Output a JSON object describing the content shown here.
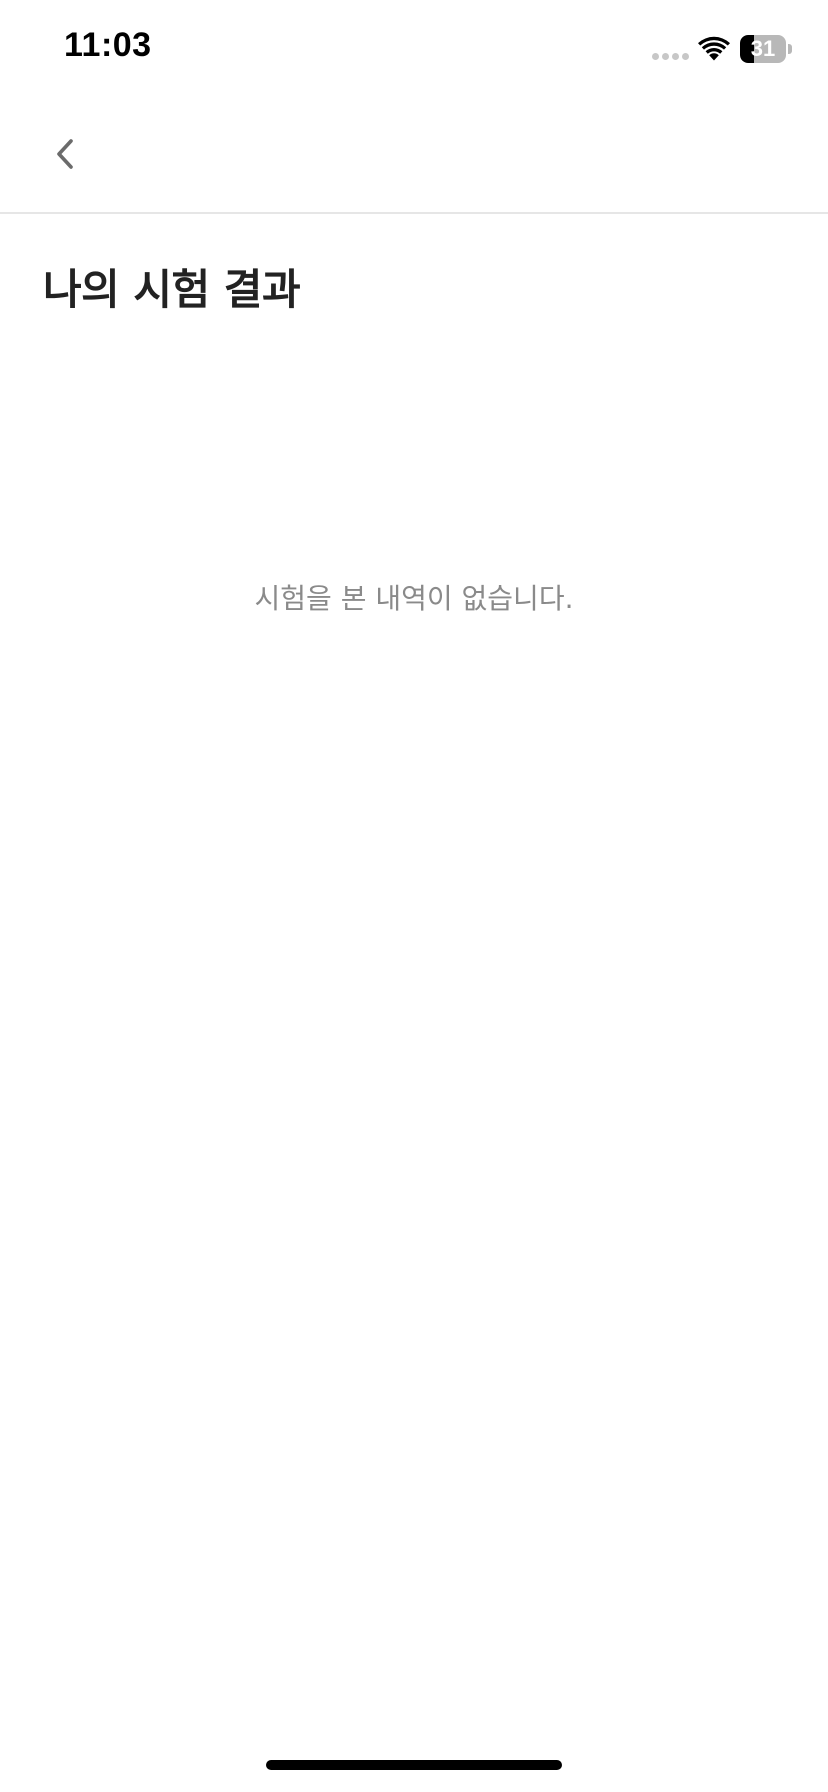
{
  "status_bar": {
    "time": "11:03",
    "battery_level": "31",
    "battery_fraction": 0.31,
    "icons": [
      "signal-dots-icon",
      "wifi-icon",
      "battery-icon"
    ]
  },
  "nav": {
    "back_icon": "chevron-left-icon"
  },
  "page": {
    "title": "나의 시험 결과",
    "empty_message": "시험을 본 내역이 없습니다."
  },
  "colors": {
    "background": "#ffffff",
    "title_text": "#222222",
    "empty_text": "#8a8a8a",
    "back_icon": "#6b6b6b",
    "divider": "#e6e6e6"
  }
}
